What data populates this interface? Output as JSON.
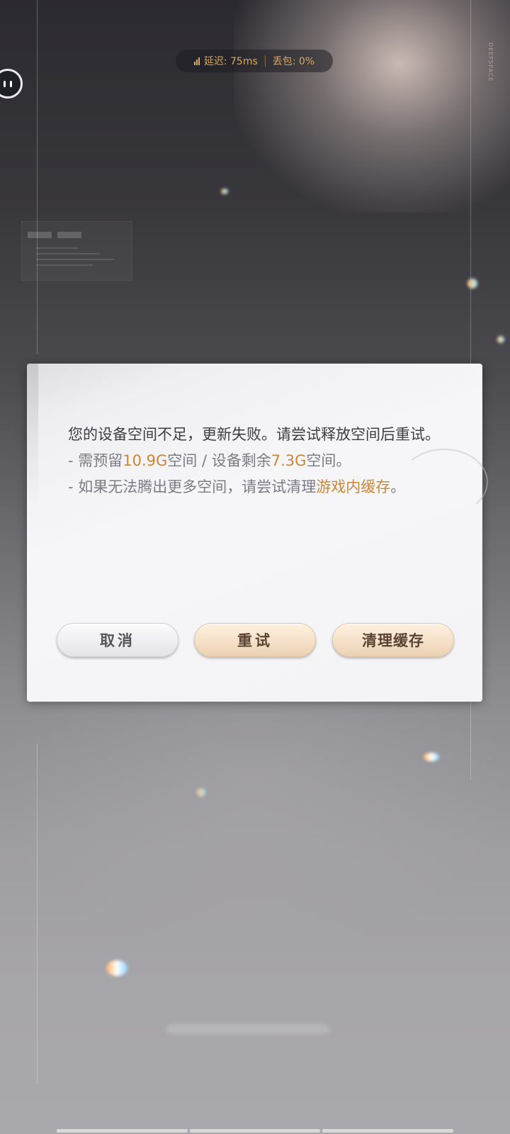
{
  "network": {
    "latency_label": "延迟: 75ms",
    "loss_label": "丢包: 0%"
  },
  "side_label": "DEEPSPACE",
  "dialog": {
    "message_line1": "您的设备空间不足，更新失败。请尝试释放空间后重试。",
    "need_prefix": "- 需预留",
    "need_value": "10.9G",
    "need_middle": "空间 / 设备剩余",
    "free_value": "7.3G",
    "need_suffix": "空间。",
    "clear_prefix": "- 如果无法腾出更多空间，请尝试清理",
    "clear_highlight": "游戏内缓存",
    "clear_suffix": "。",
    "highlight_color": "#c8873a",
    "buttons": {
      "cancel": "取消",
      "retry": "重试",
      "clear_cache": "清理缓存"
    }
  }
}
